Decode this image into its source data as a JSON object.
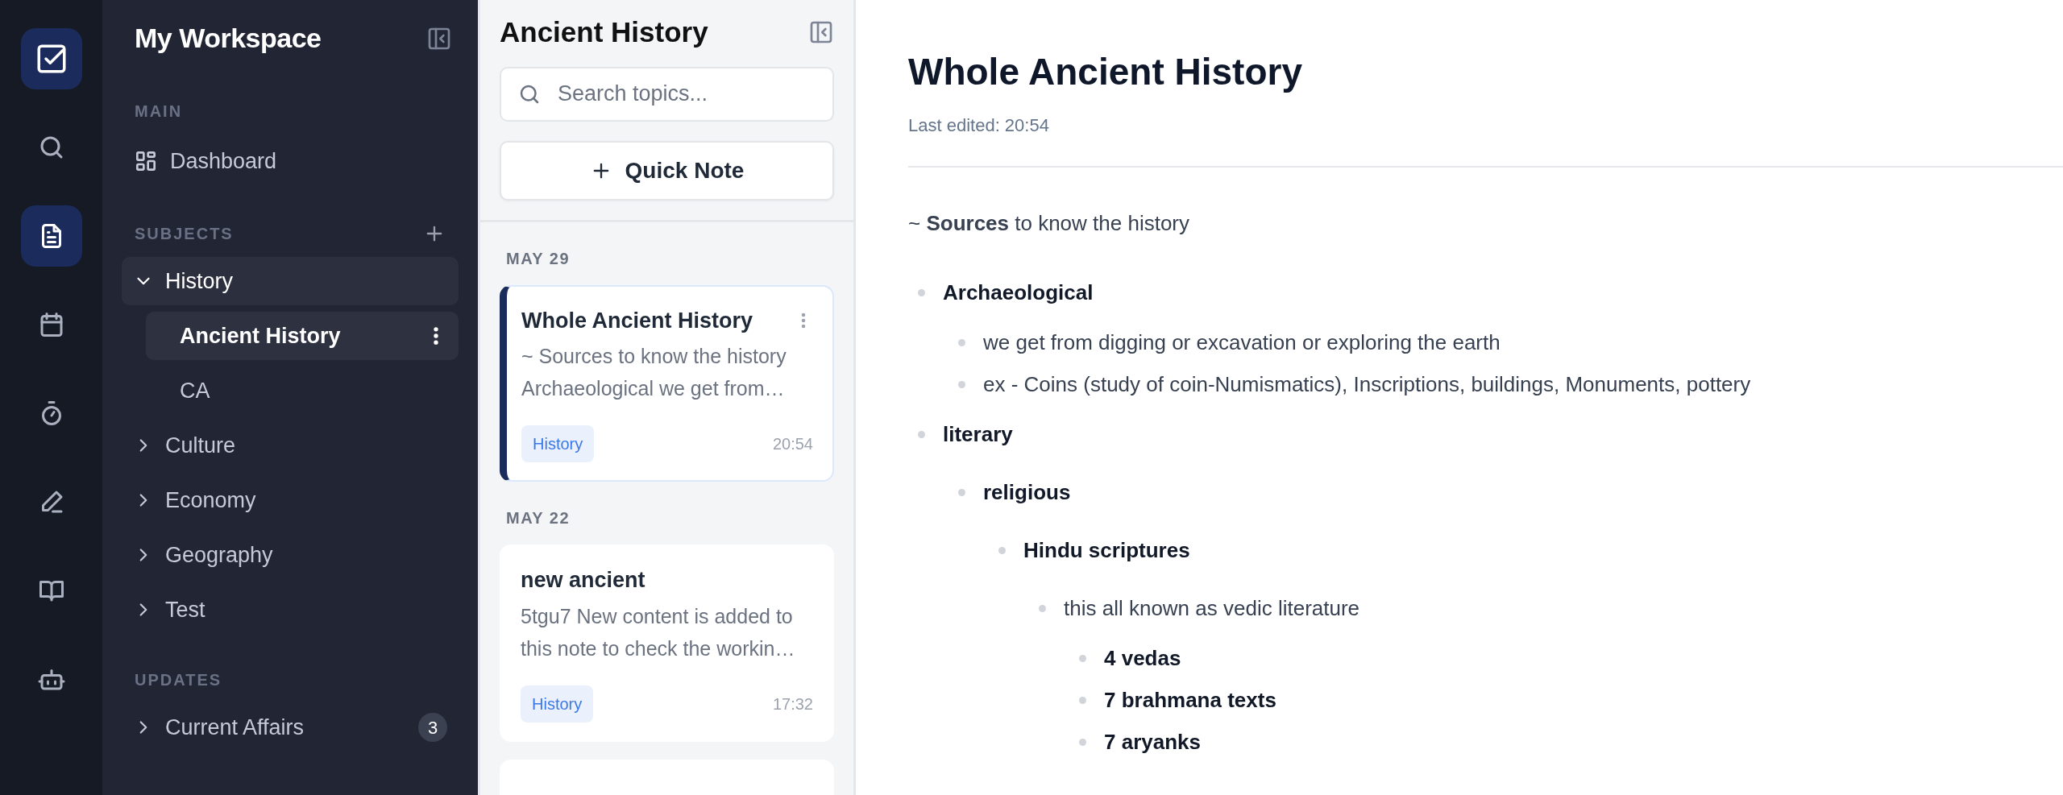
{
  "rail": [
    {
      "selected": false
    },
    {
      "selected": true
    },
    {
      "selected": false
    },
    {
      "selected": false
    },
    {
      "selected": false
    },
    {
      "selected": false
    },
    {
      "selected": false
    }
  ],
  "sidebar": {
    "title": "My Workspace",
    "sections": [
      {
        "title": "MAIN",
        "items": [
          {
            "kind": "link",
            "label": "Dashboard",
            "selected": false
          }
        ]
      },
      {
        "title": "SUBJECTS",
        "add_button": true,
        "items": [
          {
            "kind": "tree",
            "label": "History",
            "expanded": true,
            "selected": false,
            "children": [
              {
                "label": "Ancient History",
                "selected": true
              },
              {
                "label": "CA",
                "selected": false
              }
            ]
          },
          {
            "kind": "tree",
            "label": "Culture",
            "expanded": false,
            "selected": false
          },
          {
            "kind": "tree",
            "label": "Economy",
            "expanded": false,
            "selected": false
          },
          {
            "kind": "tree",
            "label": "Geography",
            "expanded": false,
            "selected": false
          },
          {
            "kind": "tree",
            "label": "Test",
            "expanded": false,
            "selected": false
          }
        ]
      },
      {
        "title": "UPDATES",
        "items": [
          {
            "kind": "tree",
            "label": "Current Affairs",
            "expanded": false,
            "selected": false,
            "badge": "3"
          }
        ]
      }
    ]
  },
  "notes_panel": {
    "title": "Ancient History",
    "search": {
      "placeholder": "Search topics..."
    },
    "quick_note": "Quick Note",
    "groups": [
      {
        "date": "MAY 29",
        "notes": [
          {
            "title": "Whole Ancient History",
            "preview_lines": [
              "~ Sources to know the history",
              "Archaeological we get from…"
            ],
            "tag": "History",
            "time": "20:54",
            "selected": true
          }
        ]
      },
      {
        "date": "MAY 22",
        "notes": [
          {
            "title": "new ancient",
            "preview_lines": [
              "5tgu7 New content is added to",
              "this note to check the workin…"
            ],
            "tag": "History",
            "time": "17:32",
            "selected": false
          }
        ]
      }
    ]
  },
  "editor": {
    "title": "Whole Ancient History",
    "last_edited": "Last edited: 20:54",
    "intro": "~ **Sources** to know the history",
    "outline": [
      {
        "text": "Archaeological",
        "bold": true,
        "children": [
          {
            "text": "we get from digging or excavation or exploring the earth",
            "bold": false
          },
          {
            "text": "ex - Coins (study of coin-Numismatics), Inscriptions, buildings, Monuments, pottery",
            "bold": false
          }
        ]
      },
      {
        "text": "literary",
        "bold": true,
        "children": [
          {
            "text": "religious",
            "bold": true,
            "children": [
              {
                "text": "Hindu scriptures",
                "bold": true,
                "children": [
                  {
                    "text": "this all known as vedic literature",
                    "bold": false,
                    "children": [
                      {
                        "text": "4 vedas",
                        "bold": true
                      },
                      {
                        "text": "7 brahmana texts",
                        "bold": true
                      },
                      {
                        "text": "7 aryanks",
                        "bold": true
                      }
                    ]
                  }
                ]
              }
            ]
          }
        ]
      }
    ]
  }
}
